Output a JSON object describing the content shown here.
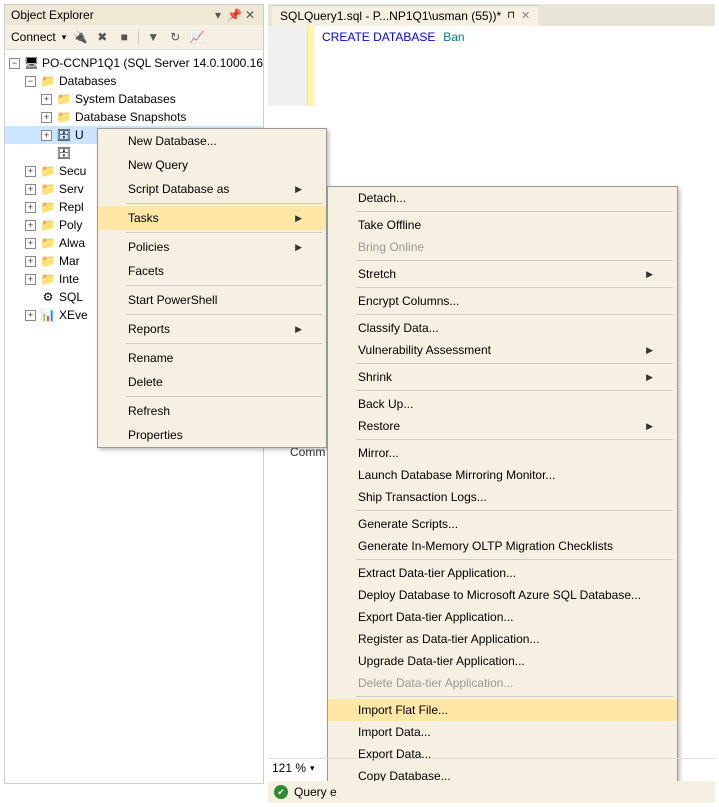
{
  "object_explorer": {
    "title": "Object Explorer",
    "connect_label": "Connect",
    "server_node": "PO-CCNP1Q1 (SQL Server 14.0.1000.16",
    "databases": "Databases",
    "system_dbs": "System Databases",
    "db_snapshots": "Database Snapshots",
    "db_user1": "U",
    "db_user2": " ",
    "folders": {
      "security": "Secu",
      "server_objects": "Serv",
      "replication": "Repl",
      "polybase": "Poly",
      "always_on": "Alwa",
      "management": "Mar",
      "integration": "Inte",
      "sql_agent": "SQL",
      "xevents": "XEve"
    }
  },
  "editor": {
    "tab_title": "SQLQuery1.sql - P...NP1Q1\\usman (55))*",
    "code_kw": "CREATE DATABASE",
    "code_name": "Ban"
  },
  "context_menu_1": {
    "new_database": "New Database...",
    "new_query": "New Query",
    "script_db": "Script Database as",
    "tasks": "Tasks",
    "policies": "Policies",
    "facets": "Facets",
    "start_powershell": "Start PowerShell",
    "reports": "Reports",
    "rename": "Rename",
    "delete": "Delete",
    "refresh": "Refresh",
    "properties": "Properties"
  },
  "context_menu_2": {
    "detach": "Detach...",
    "take_offline": "Take Offline",
    "bring_online": "Bring Online",
    "stretch": "Stretch",
    "encrypt": "Encrypt Columns...",
    "classify": "Classify Data...",
    "vuln": "Vulnerability Assessment",
    "shrink": "Shrink",
    "backup": "Back Up...",
    "restore": "Restore",
    "mirror": "Mirror...",
    "launch_mirror": "Launch Database Mirroring Monitor...",
    "ship_logs": "Ship Transaction Logs...",
    "gen_scripts": "Generate Scripts...",
    "gen_inmem": "Generate In-Memory OLTP Migration Checklists",
    "extract_dt": "Extract Data-tier Application...",
    "deploy_azure": "Deploy Database to Microsoft Azure SQL Database...",
    "export_dt": "Export Data-tier Application...",
    "register_dt": "Register as Data-tier Application...",
    "upgrade_dt": "Upgrade Data-tier Application...",
    "delete_dt": "Delete Data-tier Application...",
    "import_flat": "Import Flat File...",
    "import_data": "Import Data...",
    "export_data": "Export Data...",
    "copy_db": "Copy Database..."
  },
  "messages_label": "Comm",
  "zoom": "121 %",
  "status_text": "Query e"
}
